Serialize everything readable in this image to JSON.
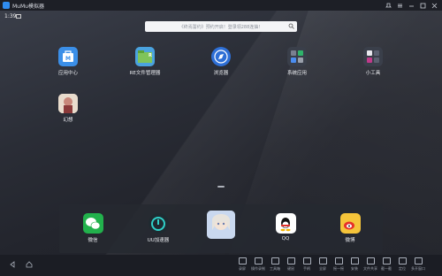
{
  "window": {
    "title": "MuMu模拟器",
    "controls": [
      "pin-icon",
      "menu-icon",
      "minimize-icon",
      "maximize-icon",
      "close-icon"
    ]
  },
  "status_bar": {
    "time": "1:39"
  },
  "search": {
    "placeholder": "《终焉誓约》预约开启！登录领288连抽！"
  },
  "apps": [
    {
      "label": "应用中心",
      "icon": "app-center-icon",
      "color": "#3b8fe8"
    },
    {
      "label": "RE文件管理器",
      "icon": "file-manager-icon",
      "color": "#4aa3df"
    },
    {
      "label": "浏览器",
      "icon": "browser-icon",
      "color": "#2e6fd6"
    },
    {
      "label": "系统应用",
      "icon": "system-apps-folder-icon",
      "color": "#3a3f4a"
    },
    {
      "label": "小工具",
      "icon": "tools-folder-icon",
      "color": "#3a3f4a"
    },
    {
      "label": "幻想",
      "icon": "game-icon",
      "color": "#d9c6b6"
    }
  ],
  "dock": [
    {
      "label": "微信",
      "icon": "wechat-icon",
      "color": "#22b14c"
    },
    {
      "label": "UU加速器",
      "icon": "uu-accelerator-icon",
      "color": "#1f2a30"
    },
    {
      "label": "",
      "icon": "anime-game-icon",
      "color": "#c9d8ef"
    },
    {
      "label": "QQ",
      "icon": "qq-icon",
      "color": "#ffffff"
    },
    {
      "label": "微博",
      "icon": "weibo-icon",
      "color": "#f5c43a"
    }
  ],
  "toolbar": {
    "nav": [
      "back-icon",
      "home-icon"
    ],
    "tools": [
      "录屏",
      "操作录制",
      "工具箱",
      "键鼠",
      "手柄",
      "全屏",
      "摇一摇",
      "安装",
      "文件共享",
      "截一截",
      "定位",
      "多开窗口"
    ]
  }
}
